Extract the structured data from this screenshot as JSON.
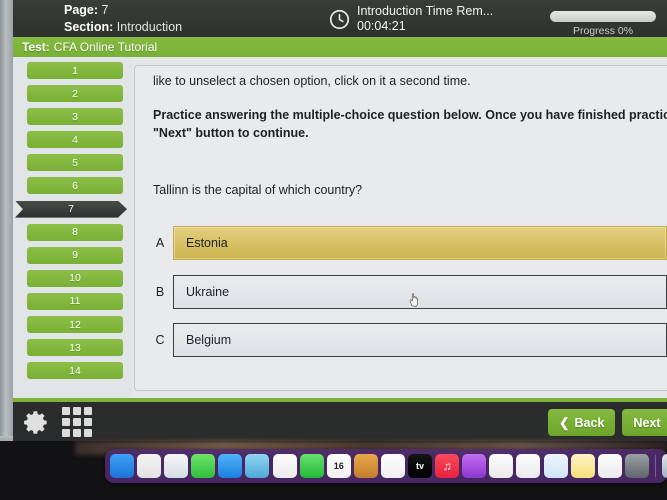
{
  "header": {
    "page_label": "Page:",
    "page_value": "7",
    "section_label": "Section:",
    "section_value": "Introduction",
    "clock_icon": "clock-icon",
    "timer_label": "Introduction Time Rem...",
    "timer_value": "00:04:21",
    "progress_label": "Progress 0%",
    "progress_percent": 0,
    "test_label": "Test:",
    "test_value": "CFA Online Tutorial",
    "green_accent": "#7cb238",
    "dark_bar": "#2f312f"
  },
  "sidebar": {
    "pages": [
      {
        "label": "1",
        "active": false
      },
      {
        "label": "2",
        "active": false
      },
      {
        "label": "3",
        "active": false
      },
      {
        "label": "4",
        "active": false
      },
      {
        "label": "5",
        "active": false
      },
      {
        "label": "6",
        "active": false
      },
      {
        "label": "7",
        "active": true
      },
      {
        "label": "8",
        "active": false
      },
      {
        "label": "9",
        "active": false
      },
      {
        "label": "10",
        "active": false
      },
      {
        "label": "11",
        "active": false
      },
      {
        "label": "12",
        "active": false
      },
      {
        "label": "13",
        "active": false
      },
      {
        "label": "14",
        "active": false
      }
    ]
  },
  "content": {
    "lead_text": "like to unselect a chosen option, click on it a second time.",
    "instruction_text": "Practice answering the multiple-choice question below. Once you have finished practici \"Next\" button to continue.",
    "question_text": "Tallinn is the capital of which country?",
    "options": [
      {
        "letter": "A",
        "text": "Estonia",
        "selected": true
      },
      {
        "letter": "B",
        "text": "Ukraine",
        "selected": false
      },
      {
        "letter": "C",
        "text": "Belgium",
        "selected": false
      }
    ],
    "selected_color": "#d8c063",
    "cursor_icon": "pointing-hand-cursor"
  },
  "footer": {
    "gear_icon": "gear-icon",
    "grid_icon": "grid-apps-icon",
    "back_label": "Back",
    "back_icon": "chevron-left-icon",
    "next_label": "Next",
    "next_icon": "chevron-right-icon"
  },
  "dock": {
    "items": [
      {
        "name": "finder-icon",
        "glyph": ""
      },
      {
        "name": "launchpad-icon",
        "glyph": ""
      },
      {
        "name": "safari-icon",
        "glyph": ""
      },
      {
        "name": "messages-icon",
        "glyph": ""
      },
      {
        "name": "mail-icon",
        "glyph": ""
      },
      {
        "name": "maps-icon",
        "glyph": ""
      },
      {
        "name": "photos-icon",
        "glyph": ""
      },
      {
        "name": "facetime-icon",
        "glyph": ""
      },
      {
        "name": "calendar-icon",
        "glyph": "16"
      },
      {
        "name": "contacts-icon",
        "glyph": ""
      },
      {
        "name": "reminders-icon",
        "glyph": ""
      },
      {
        "name": "apple-tv-icon",
        "glyph": "tv"
      },
      {
        "name": "music-icon",
        "glyph": "♫"
      },
      {
        "name": "podcasts-icon",
        "glyph": ""
      },
      {
        "name": "keynote-icon",
        "glyph": ""
      },
      {
        "name": "numbers-icon",
        "glyph": ""
      },
      {
        "name": "pages-icon",
        "glyph": ""
      },
      {
        "name": "notes-icon",
        "glyph": ""
      },
      {
        "name": "freeform-icon",
        "glyph": ""
      },
      {
        "name": "system-settings-icon",
        "glyph": ""
      },
      {
        "name": "separator",
        "glyph": ""
      },
      {
        "name": "screen-sharing-icon",
        "glyph": ""
      },
      {
        "name": "vlc-icon",
        "glyph": "▶"
      },
      {
        "name": "parallels-icon",
        "glyph": ""
      },
      {
        "name": "browser-icon",
        "glyph": ""
      }
    ]
  }
}
